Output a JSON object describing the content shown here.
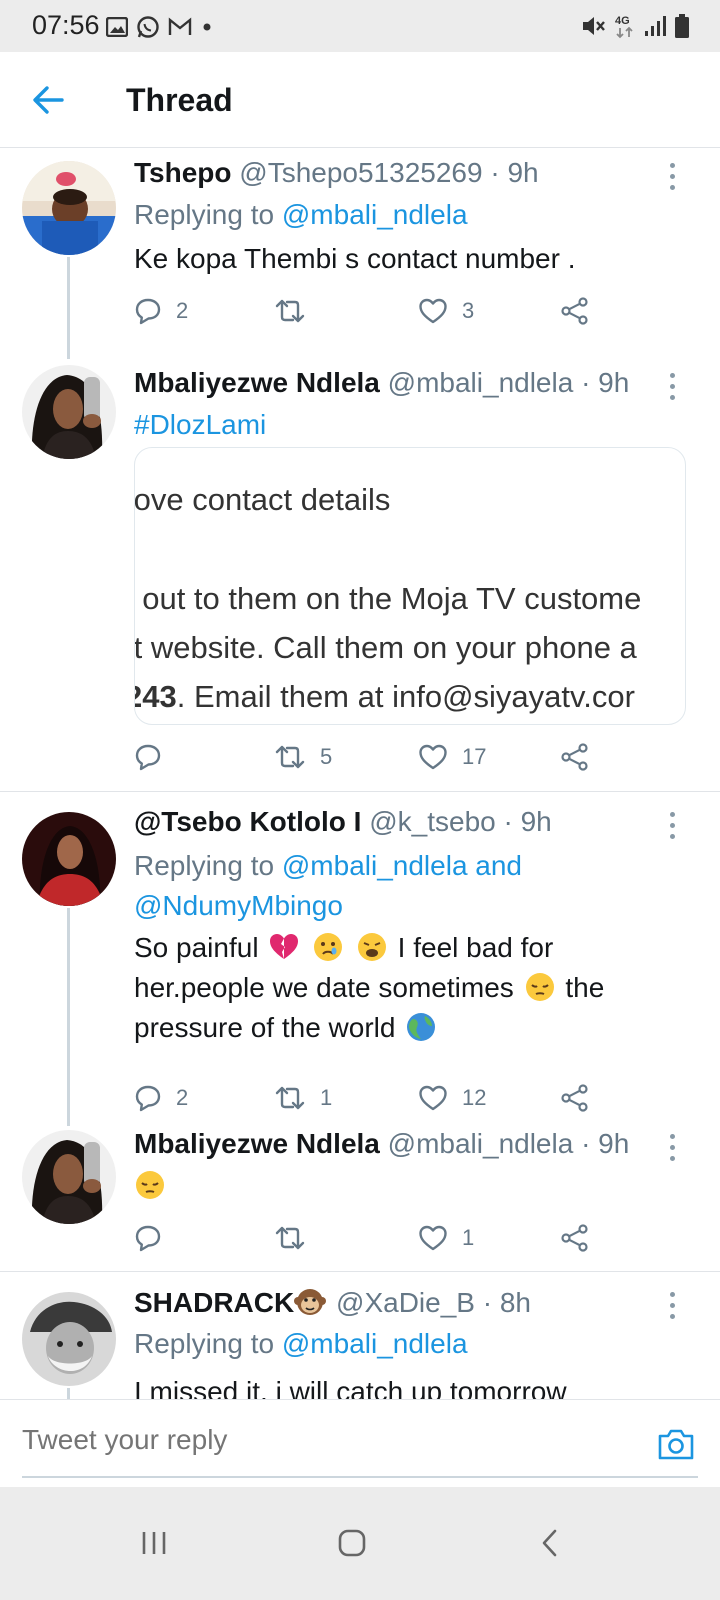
{
  "status_bar": {
    "time": "07:56",
    "left_icons": [
      "gallery-icon",
      "whatsapp-icon",
      "gmail-icon",
      "dot-icon"
    ],
    "right_icons": [
      "mute-icon",
      "4g-icon",
      "signal-icon",
      "battery-icon"
    ],
    "network_label": "4G"
  },
  "header": {
    "title": "Thread",
    "back_icon": "arrow-left-icon"
  },
  "colors": {
    "accent": "#1b95e0",
    "secondary_text": "#657786",
    "divider": "#e1e4e8"
  },
  "tweets": [
    {
      "name": "Tshepo",
      "handle": "@Tshepo51325269",
      "time": "· 9h",
      "replying_prefix": "Replying to ",
      "replying_to": "@mbali_ndlela",
      "text": "Ke kopa Thembi s contact number .",
      "reply_count": "2",
      "retweet_count": "",
      "like_count": "3"
    },
    {
      "name": "Mbaliyezwe Ndlela",
      "handle": "@mbali_ndlela",
      "time": "· 9h",
      "hashtag": "#DlozLami",
      "card_lines": [
        ".ove contact details",
        "",
        "ı out to them on the Moja TV custome",
        ":t website. Call them on your phone a",
        "243"
      ],
      "card_last_line_rest": ". Email them at info@siyayatv.cor",
      "reply_count": "",
      "retweet_count": "5",
      "like_count": "17"
    },
    {
      "name": "@Tsebo Kotlolo I",
      "handle": "@k_tsebo",
      "time": "· 9h",
      "replying_prefix": "Replying to ",
      "replying_to": "@mbali_ndlela and",
      "replying_to_2": "@NdumyMbingo",
      "text_1": "So painful",
      "text_2": "I feel bad for",
      "text_3": "her.people we date sometimes",
      "text_4": "the",
      "text_5": "pressure of the world",
      "reply_count": "2",
      "retweet_count": "1",
      "like_count": "12"
    },
    {
      "name": "Mbaliyezwe Ndlela",
      "handle": "@mbali_ndlela",
      "time": "· 9h",
      "reply_count": "",
      "retweet_count": "",
      "like_count": "1"
    },
    {
      "name": "SHADRACK",
      "handle": "@XaDie_B",
      "time": "· 8h",
      "replying_prefix": "Replying to ",
      "replying_to": "@mbali_ndlela",
      "text": "I missed it, i will catch up tomorrow"
    }
  ],
  "composer": {
    "placeholder": "Tweet your reply",
    "camera_icon": "camera-icon"
  },
  "nav_bar": {
    "buttons": [
      "recents-icon",
      "home-icon",
      "back-icon"
    ]
  }
}
